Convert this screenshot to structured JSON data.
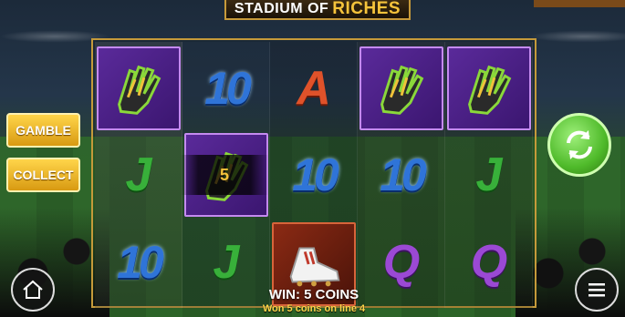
{
  "title": {
    "part1": "STADIUM OF",
    "part2": "RICHES"
  },
  "buttons": {
    "gamble": "GAMBLE",
    "collect": "COLLECT"
  },
  "reels": [
    [
      "glove",
      "J",
      "10"
    ],
    [
      "10",
      "glove",
      "J"
    ],
    [
      "A",
      "10",
      "boot"
    ],
    [
      "glove",
      "10",
      "Q"
    ],
    [
      "glove",
      "J",
      "Q"
    ]
  ],
  "win_overlay_value": "5",
  "status": {
    "win_line": "WIN:  5  COINS",
    "win_detail": "Won 5 coins on line 4"
  },
  "colors": {
    "frame": "#c59a3a",
    "gold": "#f6c33b",
    "spin": "#4fba2a"
  },
  "icons": {
    "spin": "refresh-icon",
    "home": "home-icon",
    "menu": "menu-icon"
  }
}
